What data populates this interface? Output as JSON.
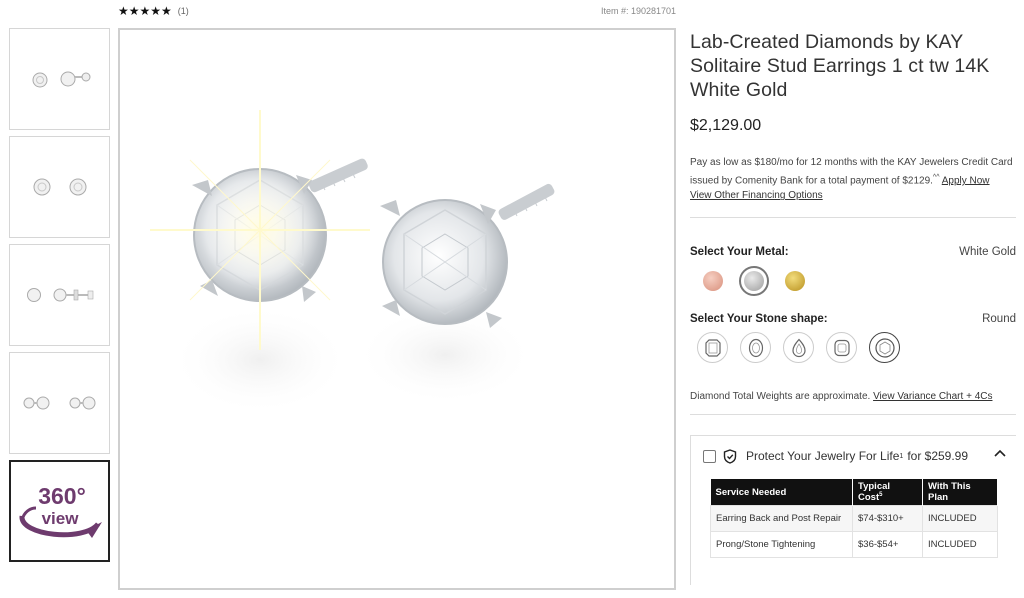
{
  "rating": {
    "stars": "★★★★★",
    "count": "(1)"
  },
  "item_number": "Item #: 190281701",
  "thumbnails": [
    {
      "name": "thumb-pair-angle"
    },
    {
      "name": "thumb-pair-front"
    },
    {
      "name": "thumb-pair-side"
    },
    {
      "name": "thumb-pair-back"
    },
    {
      "name": "thumb-360-view",
      "text_top": "360°",
      "text_bottom": "view"
    }
  ],
  "product": {
    "title": "Lab-Created Diamonds by KAY Solitaire Stud Earrings 1 ct tw 14K White Gold",
    "price": "$2,129.00",
    "finance_text": "Pay as low as $180/mo for 12 months with the KAY Jewelers Credit Card issued by Comenity Bank for a total payment of $2129.",
    "finance_sup": "^^",
    "apply_now": "Apply Now",
    "view_financing": "View Other Financing Options"
  },
  "metal": {
    "label": "Select Your Metal:",
    "selected": "White Gold",
    "options": [
      {
        "name": "Rose Gold",
        "color": "#e6a592"
      },
      {
        "name": "White Gold",
        "color": "#b9b9b9"
      },
      {
        "name": "Yellow Gold",
        "color": "#d6b43c"
      }
    ]
  },
  "stone": {
    "label": "Select Your Stone shape:",
    "selected": "Round",
    "options": [
      "emerald",
      "oval",
      "pear",
      "cushion",
      "round"
    ]
  },
  "approx": {
    "text": "Diamond Total Weights are approximate.",
    "link": "View Variance Chart + 4Cs"
  },
  "protection": {
    "label": "Protect Your Jewelry For Life",
    "label_sup": "1",
    "price": "for $259.99",
    "table": {
      "headers": [
        "Service Needed",
        "Typical Cost",
        "With This Plan"
      ],
      "header_sup": "5",
      "rows": [
        [
          "Earring Back and Post Repair",
          "$74-$310+",
          "INCLUDED"
        ],
        [
          "Prong/Stone Tightening",
          "$36-$54+",
          "INCLUDED"
        ]
      ]
    }
  }
}
